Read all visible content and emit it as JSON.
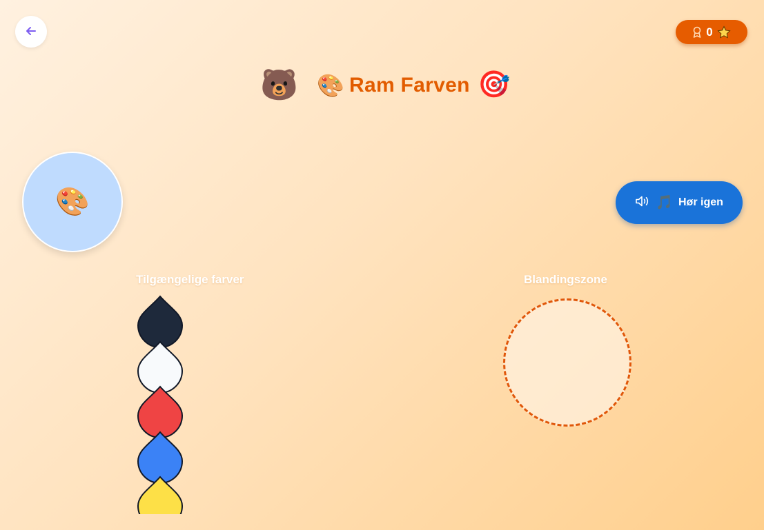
{
  "header": {
    "back_icon": "arrow-left-icon",
    "score": "0",
    "score_icons": [
      "medal-icon",
      "star-icon"
    ]
  },
  "title": {
    "bear_emoji": "🐻",
    "palette_emoji": "🎨",
    "text": "Ram Farven",
    "target_emoji": "🎯"
  },
  "target_color": {
    "emoji": "🎨",
    "color": "#bfdbfe"
  },
  "hear_again": {
    "speaker_icon": "speaker-icon",
    "note_emoji": "🎵",
    "label": "Hør igen",
    "color": "#1a73d9"
  },
  "available": {
    "label": "Tilgængelige farver",
    "colors": [
      {
        "name": "black",
        "hex": "#1e293b"
      },
      {
        "name": "white",
        "hex": "#f8fafc"
      },
      {
        "name": "red",
        "hex": "#ef4444"
      },
      {
        "name": "blue",
        "hex": "#3b82f6"
      },
      {
        "name": "yellow",
        "hex": "#fde047"
      }
    ]
  },
  "mixing": {
    "label": "Blandingszone",
    "border_color": "#e0570a"
  },
  "theme": {
    "accent": "#e65c00"
  }
}
